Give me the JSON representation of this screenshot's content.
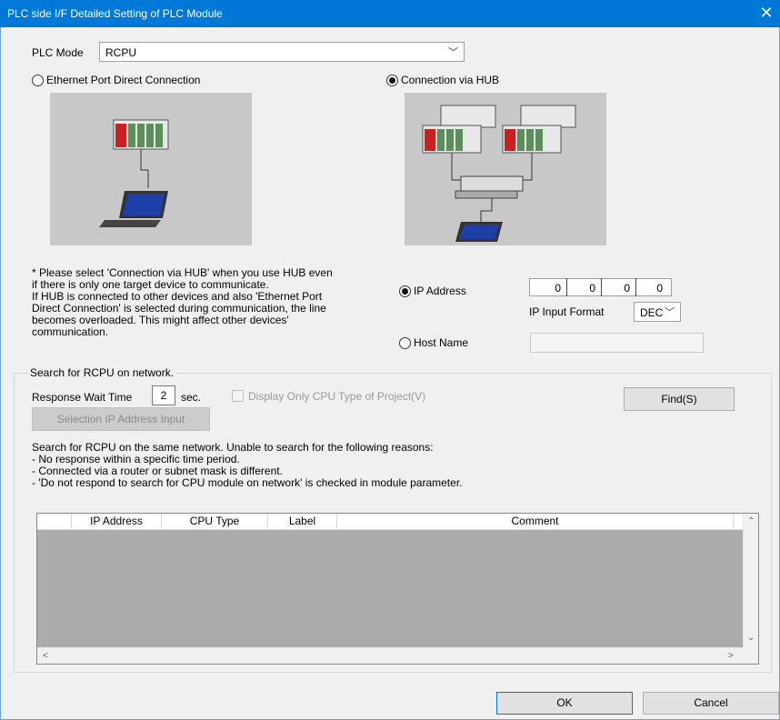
{
  "window": {
    "title": "PLC side I/F Detailed Setting of PLC Module",
    "close_glyph": "✕"
  },
  "plc_mode": {
    "label": "PLC Mode",
    "value": "RCPU",
    "chevron": "﹀"
  },
  "connection": {
    "direct_label": "Ethernet Port Direct Connection",
    "direct_selected": false,
    "hub_label": "Connection via HUB",
    "hub_selected": true
  },
  "note": {
    "lines": [
      "* Please select 'Connection via HUB' when you use HUB even",
      "if there is only one target device to communicate.",
      "If HUB is connected to other devices and also 'Ethernet Port",
      "Direct Connection' is selected during communication, the line",
      "becomes overloaded. This might affect other devices'",
      "communication."
    ]
  },
  "address": {
    "ip_label": "IP Address",
    "ip_selected": true,
    "octets": [
      "0",
      "0",
      "0",
      "0"
    ],
    "format_label": "IP Input Format",
    "format_value": "DEC",
    "host_label": "Host Name",
    "host_value": ""
  },
  "search": {
    "group_title": "Search for RCPU on network.",
    "wait_label": "Response Wait Time",
    "wait_value": "2",
    "wait_unit": "sec.",
    "display_only_label": "Display Only CPU Type of Project(V)",
    "selection_button": "Selection IP Address Input",
    "find_button": "Find(S)",
    "info_lines": [
      "Search for RCPU on the same network. Unable to search for the following reasons:",
      "- No response within a specific time period.",
      "- Connected via a router or subnet mask is different.",
      "- 'Do not respond to search for CPU module on network' is checked in module parameter."
    ],
    "columns": [
      "",
      "IP Address",
      "CPU Type",
      "Label",
      "Comment"
    ],
    "rows": []
  },
  "footer": {
    "ok": "OK",
    "cancel": "Cancel"
  },
  "icons": {
    "up": "⌃",
    "down": "⌄",
    "left": "<",
    "right": ">"
  }
}
